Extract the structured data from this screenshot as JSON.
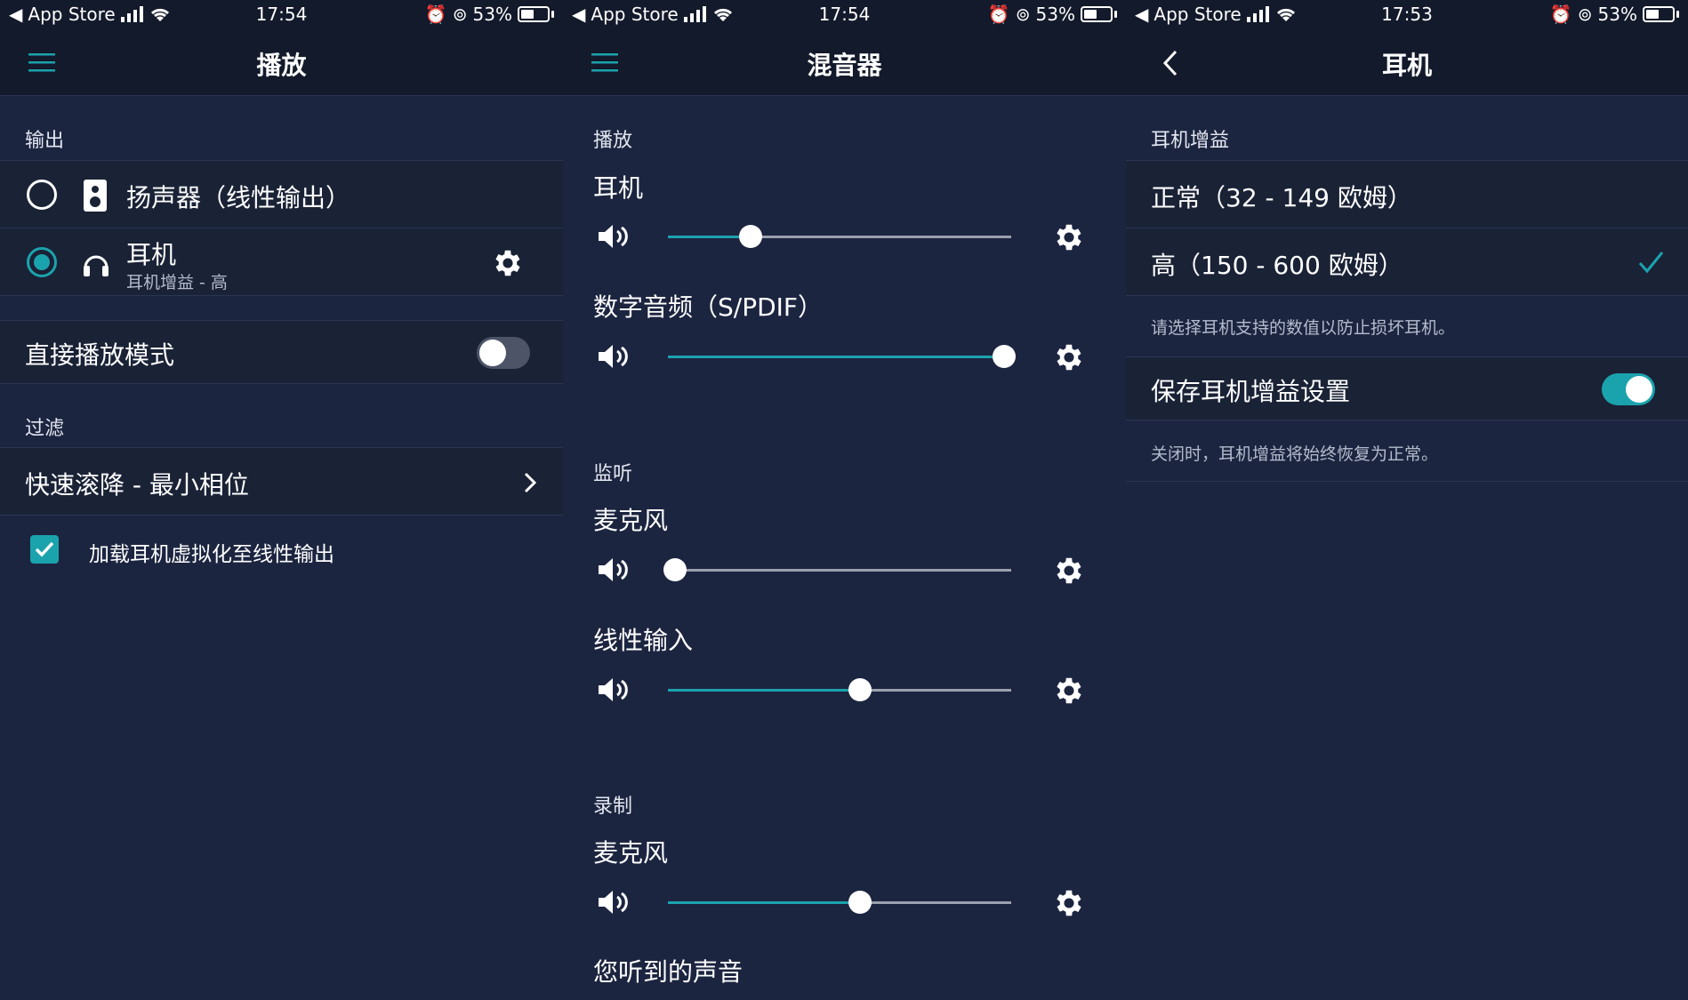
{
  "status_bars": [
    {
      "back_app": "App Store",
      "time": "17:54",
      "battery": "53%"
    },
    {
      "back_app": "App Store",
      "time": "17:54",
      "battery": "53%"
    },
    {
      "back_app": "App Store",
      "time": "17:53",
      "battery": "53%"
    }
  ],
  "playback": {
    "title": "播放",
    "output_header": "输出",
    "speaker_label": "扬声器（线性输出）",
    "headphone_label": "耳机",
    "headphone_sub": "耳机增益 - 高",
    "direct_mode_label": "直接播放模式",
    "direct_mode_on": false,
    "filter_header": "过滤",
    "filter_value": "快速滚降 - 最小相位",
    "virtualization_label": "加载耳机虚拟化至线性输出",
    "virtualization_checked": true
  },
  "mixer": {
    "title": "混音器",
    "playback_header": "播放",
    "monitor_header": "监听",
    "record_header": "录制",
    "channels": [
      {
        "label": "耳机",
        "level": 0.24
      },
      {
        "label": "数字音频（S/PDIF）",
        "level": 0.98
      },
      {
        "label": "麦克风",
        "level": 0.02
      },
      {
        "label": "线性输入",
        "level": 0.56
      },
      {
        "label": "麦克风",
        "level": 0.56
      }
    ],
    "footer_label": "您听到的声音"
  },
  "headphone": {
    "title": "耳机",
    "gain_header": "耳机增益",
    "normal_label": "正常（32 - 149 欧姆）",
    "high_label": "高（150 - 600 欧姆）",
    "selected": "high",
    "gain_note": "请选择耳机支持的数值以防止损坏耳机。",
    "save_label": "保存耳机增益设置",
    "save_on": true,
    "save_note": "关闭时，耳机增益将始终恢复为正常。"
  },
  "colors": {
    "accent": "#1ba3ad",
    "background": "#1c2540",
    "bar": "#131a2b"
  }
}
